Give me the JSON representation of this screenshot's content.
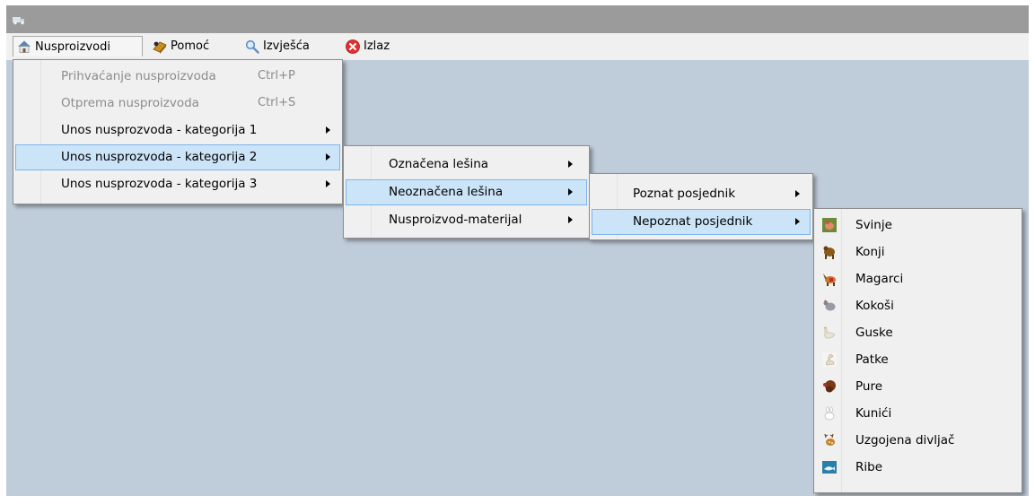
{
  "menubar": {
    "items": [
      {
        "label": "Nusproizvodi",
        "icon": "home-icon"
      },
      {
        "label": "Pomoć",
        "icon": "help-book-icon"
      },
      {
        "label": "Izvješća",
        "icon": "magnifier-icon"
      },
      {
        "label": "Izlaz",
        "icon": "exit-icon"
      }
    ]
  },
  "menu_main": {
    "items": [
      {
        "label": "Prihvaćanje nusproizvoda",
        "shortcut": "Ctrl+P",
        "enabled": false
      },
      {
        "label": "Otprema nusproizvoda",
        "shortcut": "Ctrl+S",
        "enabled": false
      },
      {
        "label": "Unos nusprozvoda - kategorija 1",
        "submenu": true
      },
      {
        "label": "Unos nusprozvoda - kategorija 2",
        "submenu": true,
        "highlighted": true
      },
      {
        "label": "Unos nusprozvoda - kategorija 3",
        "submenu": true
      }
    ]
  },
  "menu_kat2": {
    "items": [
      {
        "label": "Označena lešina",
        "submenu": true
      },
      {
        "label": "Neoznačena lešina",
        "submenu": true,
        "highlighted": true
      },
      {
        "label": "Nusproizvod-materijal",
        "submenu": true
      }
    ]
  },
  "menu_neoznacena": {
    "items": [
      {
        "label": "Poznat posjednik",
        "submenu": true
      },
      {
        "label": "Nepoznat posjednik",
        "submenu": true,
        "highlighted": true
      }
    ]
  },
  "menu_animals": {
    "items": [
      {
        "label": "Svinje",
        "icon": "pig-icon"
      },
      {
        "label": "Konji",
        "icon": "horse-icon"
      },
      {
        "label": "Magarci",
        "icon": "donkey-icon"
      },
      {
        "label": "Kokoši",
        "icon": "chicken-icon"
      },
      {
        "label": "Guske",
        "icon": "goose-icon"
      },
      {
        "label": "Patke",
        "icon": "duck-icon"
      },
      {
        "label": "Pure",
        "icon": "turkey-icon"
      },
      {
        "label": "Kunići",
        "icon": "rabbit-icon"
      },
      {
        "label": "Uzgojena divljač",
        "icon": "deer-icon"
      },
      {
        "label": "Ribe",
        "icon": "fish-icon"
      }
    ]
  },
  "colors": {
    "titlebar": "#9b9b9b",
    "client_area": "#bfccd9",
    "highlight_fill": "#cce4f7",
    "highlight_border": "#7eb4ea",
    "disabled_text": "#8c8c8c"
  }
}
